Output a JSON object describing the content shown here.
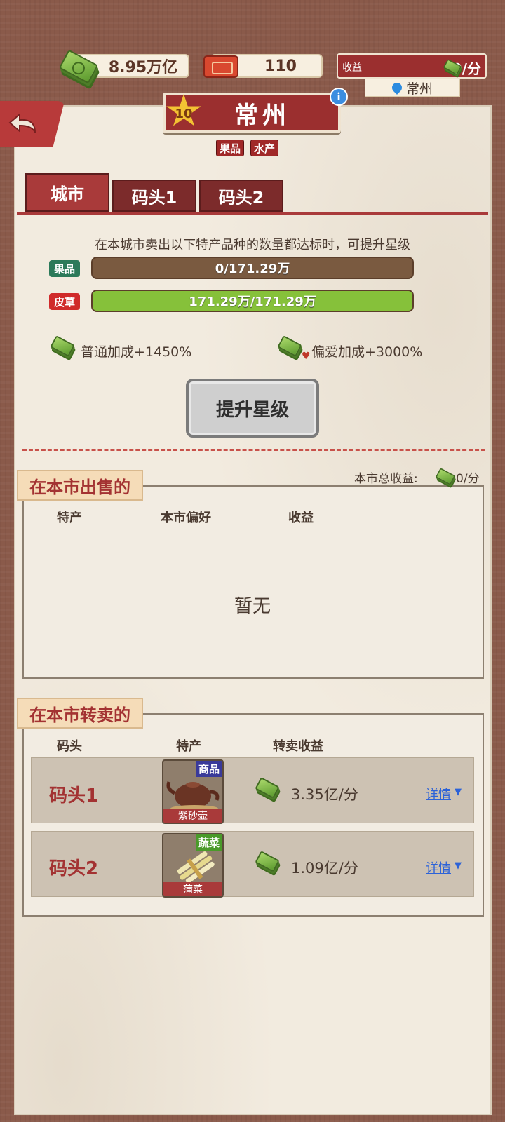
{
  "topbar": {
    "money": "8.95万亿",
    "tickets": "110",
    "income_label": "收益",
    "income_value": "0/分",
    "location": "常州"
  },
  "city": {
    "name": "常州",
    "star_level": "10",
    "tags": [
      "果品",
      "水产"
    ]
  },
  "tabs": [
    "城市",
    "码头1",
    "码头2"
  ],
  "upgrade": {
    "requirement_text": "在本城市卖出以下特产品种的数量都达标时，可提升星级",
    "items": [
      {
        "category": "果品",
        "color": "#2c7a5a",
        "progress_text": "0/171.29万",
        "fraction": 0.0
      },
      {
        "category": "皮草",
        "color": "#d02a2a",
        "progress_text": "171.29万/171.29万",
        "fraction": 1.0
      }
    ],
    "normal_bonus": "普通加成+1450%",
    "preferred_bonus": "偏爱加成+3000%",
    "button_label": "提升星级"
  },
  "sell_section": {
    "title": "在本市出售的",
    "total_label": "本市总收益:",
    "total_value": "0/分",
    "columns": [
      "特产",
      "本市偏好",
      "收益"
    ],
    "empty_text": "暂无"
  },
  "resell_section": {
    "title": "在本市转卖的",
    "columns": [
      "码头",
      "特产",
      "转卖收益"
    ],
    "rows": [
      {
        "dock": "码头1",
        "item_category": "商品",
        "item_category_color": "#3a3a9a",
        "item_name": "紫砂壶",
        "income": "3.35亿/分",
        "detail": "详情"
      },
      {
        "dock": "码头2",
        "item_category": "蔬菜",
        "item_category_color": "#4a9a2a",
        "item_name": "蒲菜",
        "income": "1.09亿/分",
        "detail": "详情"
      }
    ]
  },
  "colors": {
    "accent_red": "#a93a3a",
    "progress_green": "#86c13a",
    "link_blue": "#2c62d8"
  }
}
